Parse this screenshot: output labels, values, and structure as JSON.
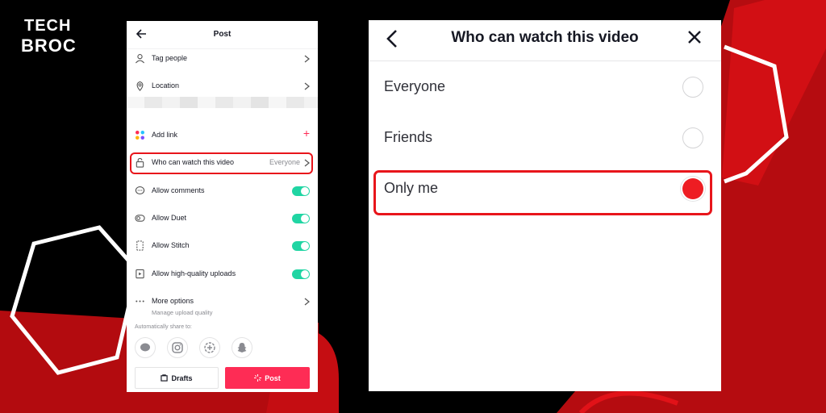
{
  "brand": {
    "logo_top": "TECH",
    "logo_bottom": "BROC"
  },
  "colors": {
    "accent_red": "#e8151b",
    "tiktok_pink": "#fe2c55",
    "toggle_green": "#20d5a3",
    "selected_radio": "#ee1d23"
  },
  "post_screen": {
    "title": "Post",
    "rows": [
      {
        "label": "Tag people",
        "icon": "person-icon"
      },
      {
        "label": "Location",
        "icon": "location-pin-icon"
      },
      {
        "label": "Add link",
        "icon": "apps-grid-icon"
      },
      {
        "label": "Who can watch this video",
        "value": "Everyone",
        "icon": "lock-icon"
      },
      {
        "label": "Allow comments",
        "icon": "comment-icon",
        "toggle_on": true
      },
      {
        "label": "Allow Duet",
        "icon": "duet-icon",
        "toggle_on": true
      },
      {
        "label": "Allow Stitch",
        "icon": "stitch-icon",
        "toggle_on": true
      },
      {
        "label": "Allow high-quality uploads",
        "icon": "hd-upload-icon",
        "toggle_on": true
      },
      {
        "label": "More options",
        "sublabel": "Manage upload quality",
        "icon": "more-dots-icon"
      }
    ],
    "share_label": "Automatically share to:",
    "share_targets": [
      "message-icon",
      "instagram-icon",
      "add-story-icon",
      "snapchat-icon"
    ],
    "drafts_label": "Drafts",
    "post_label": "Post"
  },
  "privacy_screen": {
    "title": "Who can watch this video",
    "options": [
      {
        "label": "Everyone",
        "selected": false
      },
      {
        "label": "Friends",
        "selected": false
      },
      {
        "label": "Only me",
        "selected": true
      }
    ]
  }
}
